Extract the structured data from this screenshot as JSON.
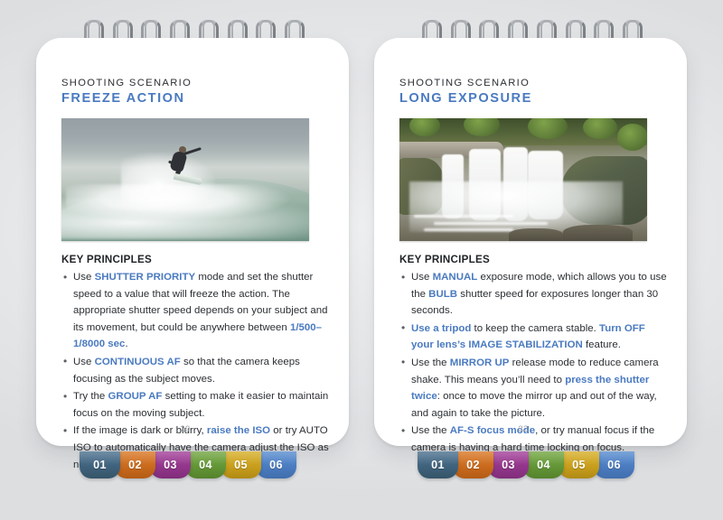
{
  "pages": [
    {
      "kicker": "SHOOTING SCENARIO",
      "title": "FREEZE ACTION",
      "photo_alt": "Surfer launching off the lip of a breaking wave",
      "key_principles_label": "KEY PRINCIPLES",
      "bullets": [
        "Use <b class=\"hl\">SHUTTER PRIORITY</b> mode and set the shutter speed to a value that will freeze the action. The appropriate shutter speed depends on your subject and its movement, but could be anywhere between <b class=\"hl\">1/500–1/8000 sec</b>.",
        "Use <b class=\"hl\">CONTINUOUS AF</b> so that the camera keeps focusing as the subject moves.",
        "Try the <b class=\"hl\">GROUP AF</b> setting to make it easier to maintain focus on the moving subject.",
        "If the image is dark or blurry, <b class=\"hl\">raise the ISO</b> or try AUTO ISO to automatically have the camera adjust the ISO as needed."
      ],
      "page_number": "29"
    },
    {
      "kicker": "SHOOTING SCENARIO",
      "title": "LONG EXPOSURE",
      "photo_alt": "Silky long-exposure waterfall over mossy rocks in a green forest",
      "key_principles_label": "KEY PRINCIPLES",
      "bullets": [
        "Use <b class=\"hl\">MANUAL</b> exposure mode, which allows you to use the <b class=\"hl\">BULB</b> shutter speed for exposures longer than 30 seconds.",
        "<b class=\"hl\">Use a tripod</b> to keep the camera stable. <b class=\"hl\">Turn OFF your lens’s IMAGE STABILIZATION</b> feature.",
        "Use the <b class=\"hl\">MIRROR UP</b> release mode to reduce camera shake. This means you’ll need to <b class=\"hl\">press the shutter twice</b>: once to move the mirror up and out of the way, and again to take the picture.",
        "Use the <b class=\"hl\">AF-S focus mode</b>, or try manual focus if the camera is having a hard time locking on focus."
      ],
      "page_number": "32"
    }
  ],
  "tabs": [
    {
      "label": "01",
      "color": "#3f627d"
    },
    {
      "label": "02",
      "color": "#c96a1d"
    },
    {
      "label": "03",
      "color": "#93368b"
    },
    {
      "label": "04",
      "color": "#639636"
    },
    {
      "label": "05",
      "color": "#c89e1c"
    },
    {
      "label": "06",
      "color": "#4b7cc0"
    }
  ],
  "accent_color": "#4a7ac0",
  "ring_count": 8
}
